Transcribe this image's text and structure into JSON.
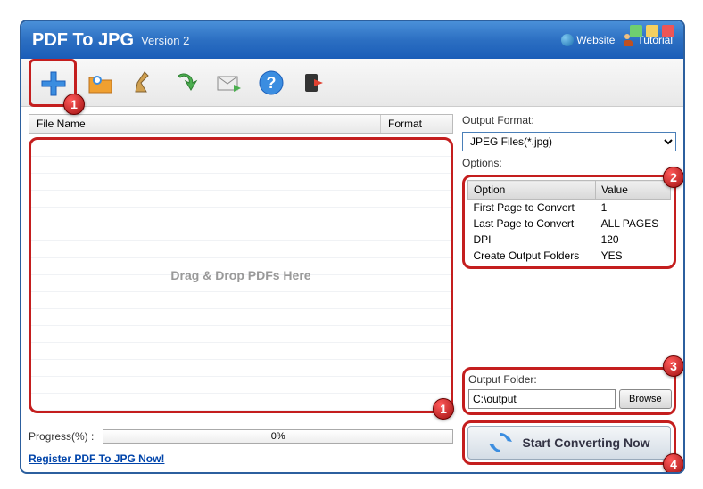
{
  "title": "PDF To JPG",
  "version": "Version 2",
  "links": {
    "website": "Website",
    "tutorial": "Tutorial"
  },
  "file_list": {
    "col_name": "File Name",
    "col_format": "Format",
    "drop_hint": "Drag & Drop PDFs Here"
  },
  "output_format": {
    "label": "Output Format:",
    "selected": "JPEG Files(*.jpg)"
  },
  "options": {
    "label": "Options:",
    "col_option": "Option",
    "col_value": "Value",
    "rows": [
      {
        "opt": "First Page to Convert",
        "val": "1"
      },
      {
        "opt": "Last Page to Convert",
        "val": "ALL PAGES"
      },
      {
        "opt": "DPI",
        "val": "120"
      },
      {
        "opt": "Create Output Folders",
        "val": "YES"
      }
    ]
  },
  "output_folder": {
    "label": "Output Folder:",
    "path": "C:\\output",
    "browse": "Browse"
  },
  "convert": {
    "label": "Start Converting Now"
  },
  "progress": {
    "label": "Progress(%)  :",
    "value": "0%"
  },
  "register": "Register PDF To JPG Now!",
  "badges": {
    "b1": "1",
    "b2": "2",
    "b3": "3",
    "b4": "4"
  }
}
